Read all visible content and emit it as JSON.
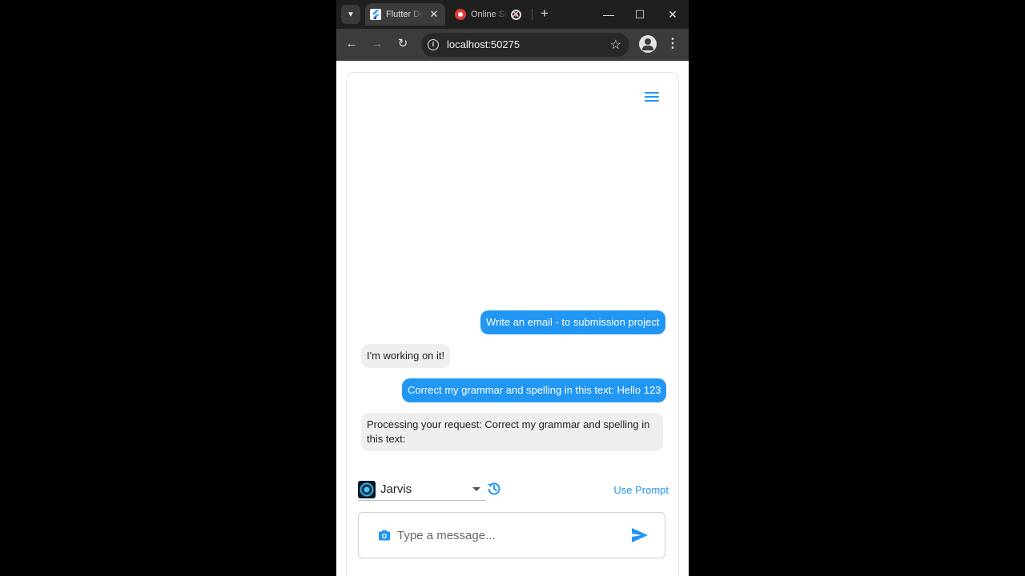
{
  "browser": {
    "tabs": [
      {
        "title": "Flutter Demo",
        "active": true
      },
      {
        "title": "Online Screen Recorder",
        "active": false
      }
    ],
    "url": "localhost:50275"
  },
  "chat": {
    "messages": [
      {
        "role": "user",
        "text": "Write an email - to submission project"
      },
      {
        "role": "bot",
        "text": "I'm working on it!"
      },
      {
        "role": "user",
        "text": "Correct my grammar and spelling in this text: Hello 123"
      },
      {
        "role": "bot",
        "text": "Processing your request: Correct my grammar and spelling in this text:"
      }
    ],
    "assistant": "Jarvis",
    "use_prompt_label": "Use Prompt",
    "input_placeholder": "Type a message..."
  },
  "colors": {
    "accent": "#2196f3",
    "bot_bubble": "#eeeeee",
    "chrome_dark": "#1f1f1f"
  }
}
